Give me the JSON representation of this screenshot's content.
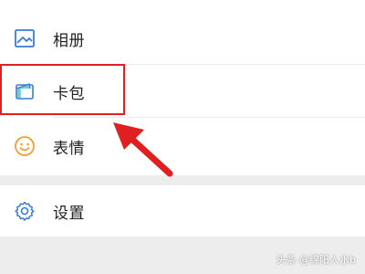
{
  "menu": {
    "items": [
      {
        "label": "相册",
        "icon": "photo-album-icon"
      },
      {
        "label": "卡包",
        "icon": "card-wallet-icon"
      },
      {
        "label": "表情",
        "icon": "smiley-face-icon"
      }
    ],
    "settings": {
      "label": "设置",
      "icon": "gear-icon"
    }
  },
  "annotation": {
    "highlight_color": "#e02020",
    "arrow_color": "#e02020"
  },
  "watermark": {
    "text": "头条 @绵阳人水b"
  },
  "colors": {
    "icon_blue": "#3a7bd5",
    "icon_orange": "#f0a030",
    "background": "#ededed",
    "row_background": "#ffffff"
  }
}
